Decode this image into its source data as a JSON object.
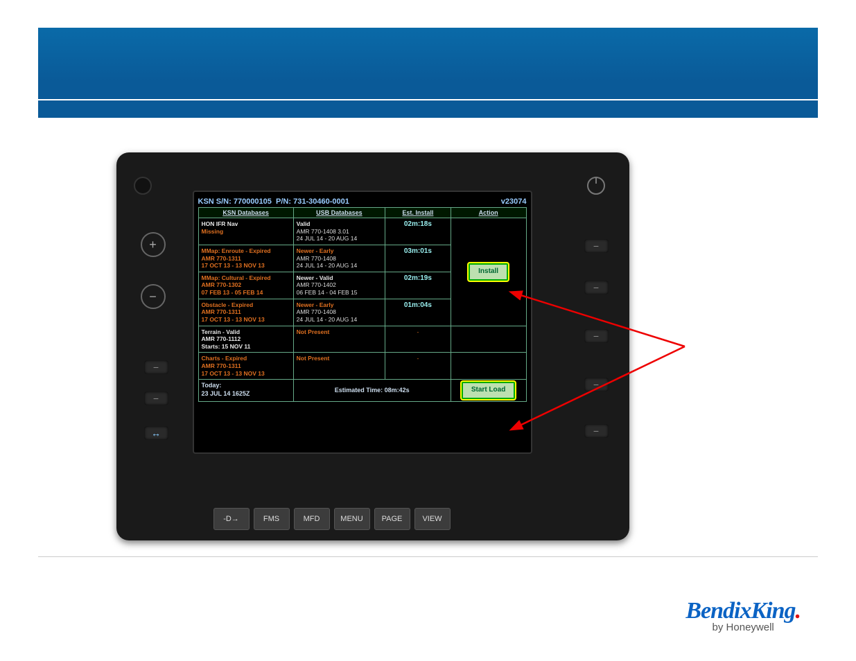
{
  "header": {
    "sn_label": "KSN S/N:",
    "sn": "770000105",
    "pn_label": "P/N:",
    "pn": "731-30460-0001",
    "version": "v23074"
  },
  "columns": {
    "c1": "KSN Databases",
    "c2": "USB Databases",
    "c3": "Est. Install",
    "c4": "Action"
  },
  "rows": [
    {
      "ksn_l1": "HON IFR Nav",
      "ksn_l2": "Missing",
      "ksn_l3": "",
      "ksn_l1_class": "white",
      "ksn_l2_class": "orange",
      "usb_l1": "Valid",
      "usb_l2": "AMR 770-1408  3.01",
      "usb_l3": "24 JUL 14 - 20 AUG 14",
      "usb_l1_class": "white",
      "est": "02m:18s"
    },
    {
      "ksn_l1": "MMap: Enroute - Expired",
      "ksn_l2": "AMR 770-1311",
      "ksn_l3": "17 OCT 13 - 13 NOV 13",
      "ksn_l1_class": "orange",
      "ksn_l2_class": "orange",
      "usb_l1": "Newer - Early",
      "usb_l2": "AMR 770-1408",
      "usb_l3": "24 JUL 14 - 20 AUG 14",
      "usb_l1_class": "orange",
      "est": "03m:01s"
    },
    {
      "ksn_l1": "MMap: Cultural - Expired",
      "ksn_l2": "AMR 770-1302",
      "ksn_l3": "07 FEB 13 - 05 FEB 14",
      "ksn_l1_class": "orange",
      "ksn_l2_class": "orange",
      "usb_l1": "Newer - Valid",
      "usb_l2": "AMR 770-1402",
      "usb_l3": "06 FEB 14 - 04 FEB 15",
      "usb_l1_class": "white",
      "est": "02m:19s"
    },
    {
      "ksn_l1": "Obstacle - Expired",
      "ksn_l2": "AMR 770-1311",
      "ksn_l3": "17 OCT 13 - 13 NOV 13",
      "ksn_l1_class": "orange",
      "ksn_l2_class": "orange",
      "usb_l1": "Newer - Early",
      "usb_l2": "AMR 770-1408",
      "usb_l3": "24 JUL 14 - 20 AUG 14",
      "usb_l1_class": "orange",
      "est": "01m:04s"
    },
    {
      "ksn_l1": "Terrain - Valid",
      "ksn_l2": "AMR 770-1112",
      "ksn_l3": "Starts: 15 NOV 11",
      "ksn_l1_class": "white",
      "ksn_l2_class": "white",
      "usb_l1": "Not Present",
      "usb_l2": "",
      "usb_l3": "",
      "usb_l1_class": "orange",
      "est": "-"
    },
    {
      "ksn_l1": "Charts - Expired",
      "ksn_l2": "AMR 770-1311",
      "ksn_l3": "17 OCT 13 - 13 NOV 13",
      "ksn_l1_class": "orange",
      "ksn_l2_class": "orange",
      "usb_l1": "Not Present",
      "usb_l2": "",
      "usb_l3": "",
      "usb_l1_class": "orange",
      "est": "-"
    }
  ],
  "action": {
    "install": "Install",
    "start": "Start Load"
  },
  "footer": {
    "today_label": "Today:",
    "today_value": "23 JUL 14 1625Z",
    "est_label": "Estimated Time:",
    "est_value": "08m:42s"
  },
  "softkeys": [
    "-D→",
    "FMS",
    "MFD",
    "MENU",
    "PAGE",
    "VIEW"
  ],
  "logo": {
    "brand": "BendixKing",
    "dot": ".",
    "byline": "by Honeywell"
  }
}
